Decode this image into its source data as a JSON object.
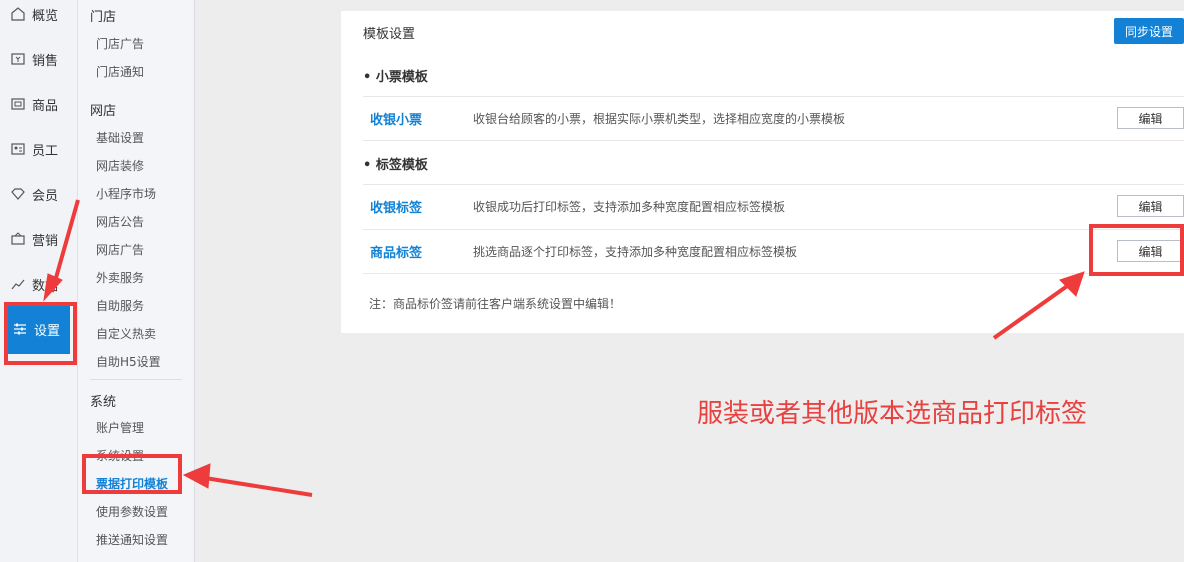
{
  "primary_nav": [
    {
      "label": "概览",
      "icon": "home-icon"
    },
    {
      "label": "销售",
      "icon": "sales-icon"
    },
    {
      "label": "商品",
      "icon": "goods-icon"
    },
    {
      "label": "员工",
      "icon": "staff-icon"
    },
    {
      "label": "会员",
      "icon": "member-icon"
    },
    {
      "label": "营销",
      "icon": "marketing-icon"
    },
    {
      "label": "数据",
      "icon": "chart-icon"
    },
    {
      "label": "设置",
      "icon": "settings-icon",
      "active": true
    }
  ],
  "secondary_nav": {
    "store": {
      "title": "门店",
      "items": [
        "门店广告",
        "门店通知"
      ]
    },
    "online_store": {
      "title": "网店",
      "items": [
        "基础设置",
        "网店装修",
        "小程序市场",
        "网店公告",
        "网店广告",
        "外卖服务",
        "自助服务",
        "自定义热卖",
        "自助H5设置"
      ]
    },
    "system": {
      "title": "系统",
      "items": [
        "账户管理",
        "系统设置",
        "票据打印模板",
        "使用参数设置",
        "推送通知设置"
      ],
      "active_item": "票据打印模板"
    }
  },
  "panel": {
    "title": "模板设置",
    "sync_label": "同步设置",
    "receipt_section": "• 小票模板",
    "label_section": "• 标签模板",
    "rows": [
      {
        "name": "收银小票",
        "desc": "收银台给顾客的小票，根据实际小票机类型，选择相应宽度的小票模板",
        "edit": "编辑"
      },
      {
        "name": "收银标签",
        "desc": "收银成功后打印标签，支持添加多种宽度配置相应标签模板",
        "edit": "编辑"
      },
      {
        "name": "商品标签",
        "desc": "挑选商品逐个打印标签，支持添加多种宽度配置相应标签模板",
        "edit": "编辑"
      }
    ],
    "note": "注：商品标价签请前往客户端系统设置中编辑！"
  },
  "annotation": {
    "text": "服装或者其他版本选商品打印标签",
    "color": "#e8413f"
  },
  "colors": {
    "accent": "#1382d6",
    "highlight": "#ee3b3b"
  }
}
